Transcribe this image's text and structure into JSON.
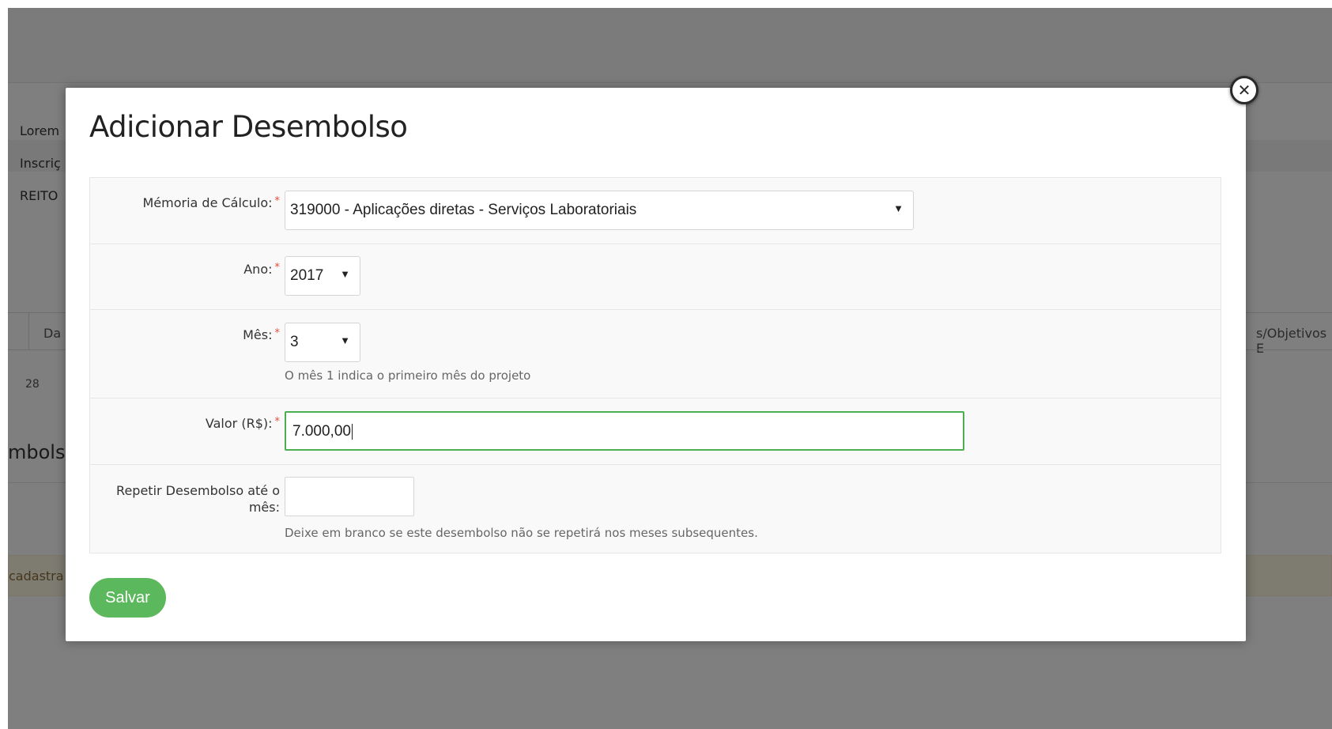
{
  "background_page": {
    "info_lines": [
      "Lorem",
      "Inscriç",
      "REITO"
    ],
    "tab_left": "Da",
    "tab_right": "s/Objetivos E",
    "count": "28",
    "heading": "mbols",
    "alert_text": "cadastra"
  },
  "modal": {
    "title": "Adicionar Desembolso",
    "close_icon": "close-x-icon",
    "fields": {
      "memoria": {
        "label": "Mémoria de Cálculo:",
        "value": "319000 - Aplicações diretas - Serviços Laboratoriais"
      },
      "ano": {
        "label": "Ano:",
        "value": "2017"
      },
      "mes": {
        "label": "Mês:",
        "value": "3",
        "help": "O mês 1 indica o primeiro mês do projeto"
      },
      "valor": {
        "label": "Valor (R$):",
        "value": "7.000,00"
      },
      "repetir": {
        "label": "Repetir Desembolso até o mês:",
        "value": "",
        "help": "Deixe em branco se este desembolso não se repetirá nos meses subsequentes."
      }
    },
    "required_mark": "*",
    "select_arrow": "▼",
    "save_label": "Salvar"
  },
  "colors": {
    "overlay": "#000000",
    "save_button": "#5cb85c",
    "focus_border": "#4caf50",
    "required": "#e74c3c",
    "alert_bg": "#fcf8e3"
  }
}
